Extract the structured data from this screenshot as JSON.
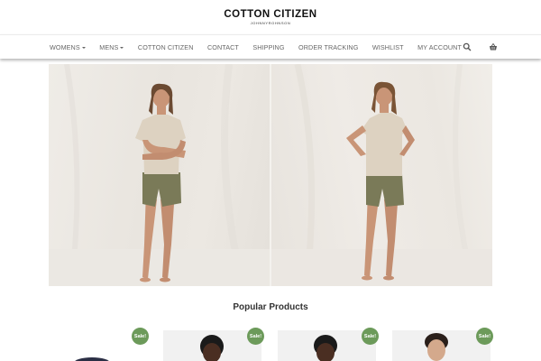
{
  "brand": {
    "name": "COTTON CITIZEN",
    "tagline": "JOHNNYROHNSON"
  },
  "nav": {
    "items": [
      {
        "label": "WOMENS",
        "dropdown": true
      },
      {
        "label": "MENS",
        "dropdown": true
      },
      {
        "label": "COTTON CITIZEN",
        "dropdown": false
      },
      {
        "label": "CONTACT",
        "dropdown": false
      },
      {
        "label": "SHIPPING",
        "dropdown": false
      },
      {
        "label": "ORDER TRACKING",
        "dropdown": false
      },
      {
        "label": "WISHLIST",
        "dropdown": false
      },
      {
        "label": "MY ACCOUNT",
        "dropdown": false
      }
    ],
    "icons": [
      "search-icon",
      "basket-icon"
    ]
  },
  "hero": {
    "panels": [
      "model-arms-crossed",
      "model-hands-on-hips"
    ]
  },
  "popular": {
    "title": "Popular Products",
    "products": [
      {
        "badge": "Sale!"
      },
      {
        "badge": "Sale!"
      },
      {
        "badge": "Sale!"
      },
      {
        "badge": "Sale!"
      }
    ]
  },
  "colors": {
    "sale_badge": "#6c9a5a",
    "nav_text": "#666666"
  }
}
